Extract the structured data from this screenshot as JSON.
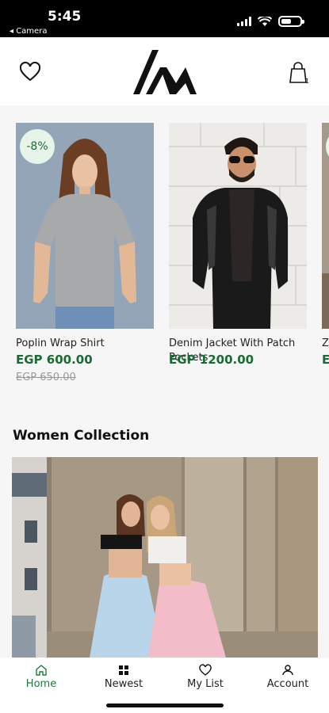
{
  "status_bar": {
    "time": "5:45",
    "back_label": "◂ Camera"
  },
  "header": {
    "logo_alt": "IM"
  },
  "products": [
    {
      "name": "Poplin Wrap Shirt",
      "price": "EGP 600.00",
      "old_price": "EGP 650.00",
      "discount": "-8%"
    },
    {
      "name": "Denim Jacket With Patch Pockets",
      "price": "EGP 1200.00",
      "old_price": "",
      "discount": ""
    },
    {
      "name": "Zi",
      "price": "E",
      "old_price": "",
      "discount": "-"
    }
  ],
  "section": {
    "title": "Women Collection"
  },
  "tabs": [
    {
      "label": "Home",
      "icon": "home-icon",
      "active": true
    },
    {
      "label": "Newest",
      "icon": "grid-icon",
      "active": false
    },
    {
      "label": "My List",
      "icon": "heart-icon",
      "active": false
    },
    {
      "label": "Account",
      "icon": "person-icon",
      "active": false
    }
  ],
  "colors": {
    "accent": "#1e7a3c",
    "price": "#1a6b33",
    "badge_bg": "#e6f4ea"
  }
}
